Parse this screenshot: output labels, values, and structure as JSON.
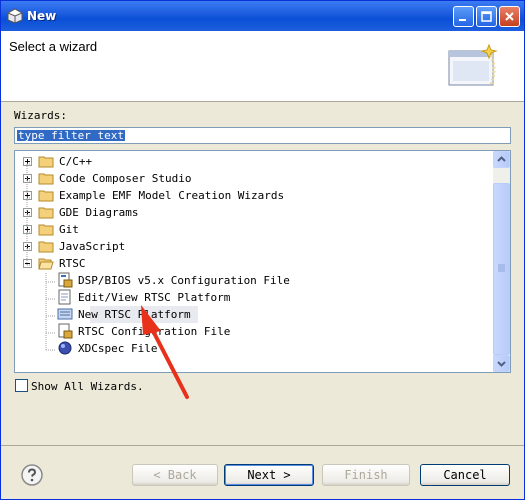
{
  "window": {
    "title": "New"
  },
  "banner": {
    "title": "Select a wizard"
  },
  "filter": {
    "label": "Wizards:",
    "value": "type filter text"
  },
  "tree": {
    "rows": [
      {
        "label": "C/C++"
      },
      {
        "label": "Code Composer Studio"
      },
      {
        "label": "Example EMF Model Creation Wizards"
      },
      {
        "label": "GDE Diagrams"
      },
      {
        "label": "Git"
      },
      {
        "label": "JavaScript"
      },
      {
        "label": "RTSC"
      },
      {
        "label": "DSP/BIOS v5.x Configuration File"
      },
      {
        "label": "Edit/View RTSC Platform"
      },
      {
        "label": "New RTSC Platform"
      },
      {
        "label": "RTSC Configuration File"
      },
      {
        "label": "XDCspec File"
      }
    ]
  },
  "options": {
    "show_all_label": "Show All Wizards."
  },
  "buttons": {
    "back": "< Back",
    "next": "Next >",
    "finish": "Finish",
    "cancel": "Cancel"
  },
  "colors": {
    "titlebar": "#0a4fd6",
    "selection": "#316ac5",
    "annotation_arrow": "#e8311a"
  }
}
